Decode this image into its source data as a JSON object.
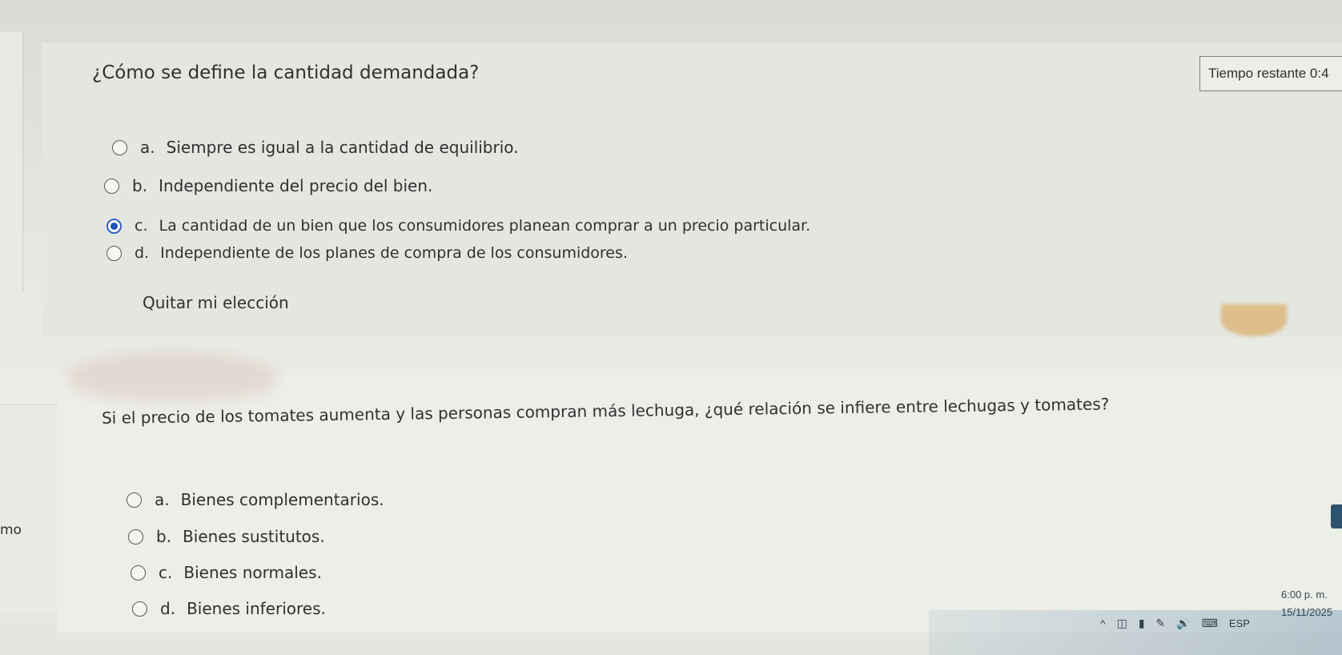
{
  "timer": {
    "label": "Tiempo restante 0:4"
  },
  "question1": {
    "title": "¿Cómo se define la cantidad demandada?",
    "options": [
      {
        "letter": "a.",
        "text": "Siempre es igual a la cantidad de equilibrio.",
        "selected": false
      },
      {
        "letter": "b.",
        "text": "Independiente del precio del bien.",
        "selected": false
      },
      {
        "letter": "c.",
        "text": "La cantidad de un bien que los consumidores planean comprar a un precio particular.",
        "selected": true
      },
      {
        "letter": "d.",
        "text": "Independiente de los planes de compra de los consumidores.",
        "selected": false
      }
    ],
    "clear_label": "Quitar mi elección"
  },
  "question2": {
    "title": "Si el precio de los tomates aumenta y las personas compran más lechuga, ¿qué relación se infiere entre lechugas y tomates?",
    "options": [
      {
        "letter": "a.",
        "text": "Bienes complementarios.",
        "selected": false
      },
      {
        "letter": "b.",
        "text": "Bienes sustitutos.",
        "selected": false
      },
      {
        "letter": "c.",
        "text": "Bienes normales.",
        "selected": false
      },
      {
        "letter": "d.",
        "text": "Bienes inferiores.",
        "selected": false
      }
    ]
  },
  "side_fragment": "mo",
  "taskbar": {
    "language": "ESP",
    "time": "6:00 p. m.",
    "date": "15/11/2025",
    "icons": [
      "chevron-up-icon",
      "network-icon",
      "battery-icon",
      "pen-icon",
      "volume-icon",
      "keyboard-icon"
    ]
  }
}
